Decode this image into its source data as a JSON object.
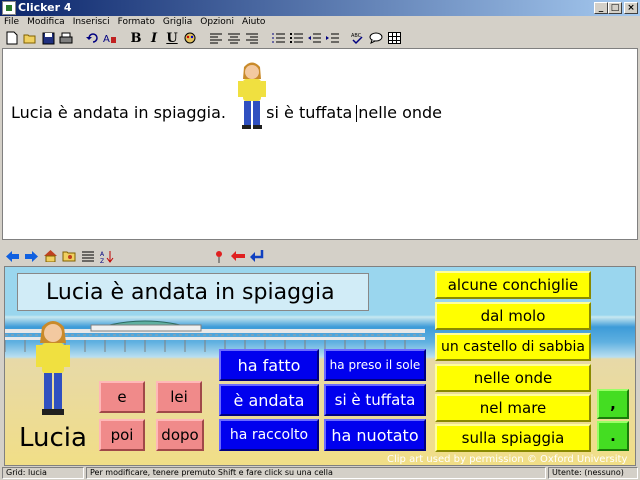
{
  "window": {
    "title": "Clicker 4"
  },
  "menu": [
    "File",
    "Modifica",
    "Inserisci",
    "Formato",
    "Griglia",
    "Opzioni",
    "Aiuto"
  ],
  "toolbar": {
    "icons": [
      "new-icon",
      "open-icon",
      "save-icon",
      "print-icon",
      "undo-icon",
      "spell-color-icon",
      "bold-icon",
      "italic-icon",
      "underline-icon",
      "color-icon",
      "align-left-icon",
      "align-center-icon",
      "align-right-icon",
      "numbered-list-icon",
      "bullet-list-icon",
      "outdent-icon",
      "indent-icon",
      "spellcheck-icon",
      "comment-icon",
      "grid-icon"
    ],
    "bold": "B",
    "italic": "I",
    "underline": "U"
  },
  "document": {
    "text_before": "Lucia è andata in spiaggia.",
    "text_after": "si è tuffata",
    "text_end": "nelle onde"
  },
  "gridbar": {
    "icons": [
      "back-arrow-icon",
      "forward-arrow-icon",
      "home-icon",
      "folder-icon",
      "list-icon",
      "sort-icon",
      "pin-icon",
      "red-arrow-icon",
      "enter-icon"
    ]
  },
  "grid": {
    "sentence": "Lucia è andata in spiaggia",
    "name_label": "Lucia",
    "pink": [
      "e",
      "lei",
      "poi",
      "dopo"
    ],
    "blue": [
      "ha fatto",
      "ha preso il sole",
      "è andata",
      "si è tuffata",
      "ha raccolto",
      "ha nuotato"
    ],
    "yellow": [
      "alcune conchiglie",
      "dal molo",
      "un castello di sabbia",
      "nelle onde",
      "nel mare",
      "sulla spiaggia"
    ],
    "green": [
      ",",
      "."
    ],
    "credit": "Clip art used by permission  © Oxford University Press"
  },
  "status": {
    "grid": "Grid: lucia",
    "hint": "Per modificare, tenere premuto Shift e fare click su una cella",
    "user": "Utente: (nessuno)"
  },
  "colors": {
    "blue_cell": "#0000ee",
    "pink_cell": "#f08a8a",
    "yellow_cell": "#ffff00",
    "green_cell": "#44dd22",
    "titlebar": "#0a246a"
  }
}
